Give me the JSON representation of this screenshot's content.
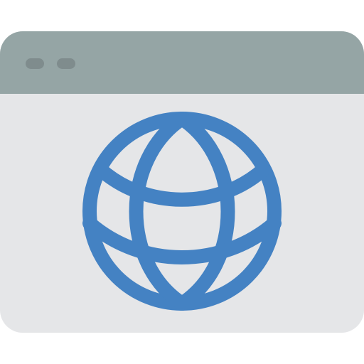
{
  "colors": {
    "titlebar": "#95a5a5",
    "body": "#e5e6e8",
    "dot": "#7f8c8d",
    "globe_stroke": "#4482c3"
  },
  "icons": {
    "window": "browser-window-icon",
    "globe": "globe-icon"
  }
}
